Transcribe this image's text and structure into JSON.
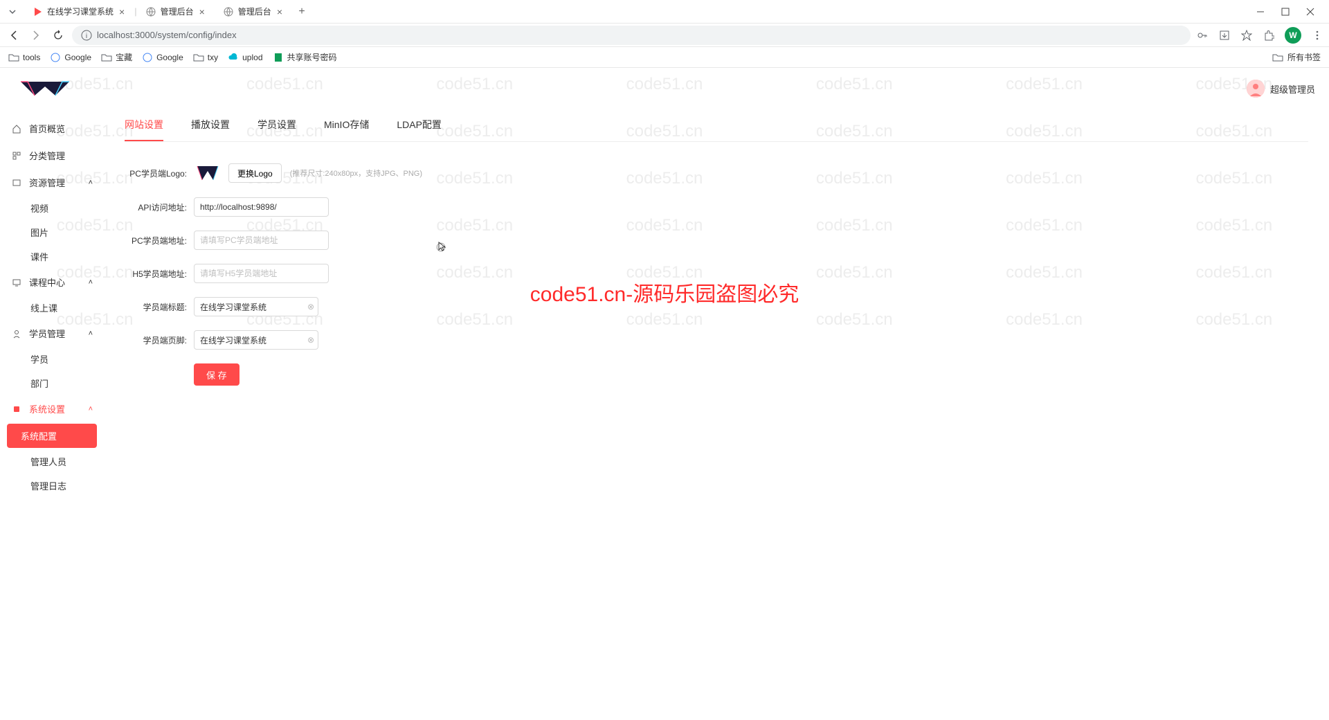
{
  "browser": {
    "tabs": [
      {
        "title": "在线学习课堂系统"
      },
      {
        "title": "管理后台"
      },
      {
        "title": "管理后台"
      }
    ],
    "url": "localhost:3000/system/config/index",
    "bookmarks": [
      "tools",
      "Google",
      "宝藏",
      "Google",
      "txy",
      "uplod",
      "共享账号密码"
    ],
    "all_bookmarks": "所有书签",
    "avatar_letter": "W"
  },
  "app": {
    "user_name": "超级管理员",
    "sidebar": [
      {
        "label": "首页概览",
        "type": "item"
      },
      {
        "label": "分类管理",
        "type": "item"
      },
      {
        "label": "资源管理",
        "type": "group"
      },
      {
        "label": "视频",
        "type": "sub"
      },
      {
        "label": "图片",
        "type": "sub"
      },
      {
        "label": "课件",
        "type": "sub"
      },
      {
        "label": "课程中心",
        "type": "group"
      },
      {
        "label": "线上课",
        "type": "sub"
      },
      {
        "label": "学员管理",
        "type": "group"
      },
      {
        "label": "学员",
        "type": "sub"
      },
      {
        "label": "部门",
        "type": "sub"
      },
      {
        "label": "系统设置",
        "type": "group",
        "active": true
      },
      {
        "label": "系统配置",
        "type": "sub",
        "active": true
      },
      {
        "label": "管理人员",
        "type": "sub"
      },
      {
        "label": "管理日志",
        "type": "sub"
      }
    ],
    "content_tabs": [
      "网站设置",
      "播放设置",
      "学员设置",
      "MinIO存储",
      "LDAP配置"
    ],
    "form": {
      "logo_label": "PC学员端Logo:",
      "change_logo_btn": "更换Logo",
      "logo_hint": "(推荐尺寸:240x80px，支持JPG、PNG)",
      "api_label": "API访问地址:",
      "api_value": "http://localhost:9898/",
      "pc_addr_label": "PC学员端地址:",
      "pc_addr_placeholder": "请填写PC学员端地址",
      "h5_addr_label": "H5学员端地址:",
      "h5_addr_placeholder": "请填写H5学员端地址",
      "title_label": "学员端标题:",
      "title_value": "在线学习课堂系统",
      "footer_label": "学员端页脚:",
      "footer_value": "在线学习课堂系统",
      "save_btn": "保 存"
    }
  },
  "watermark_text": "code51.cn",
  "overlay_text": "code51.cn-源码乐园盗图必究"
}
